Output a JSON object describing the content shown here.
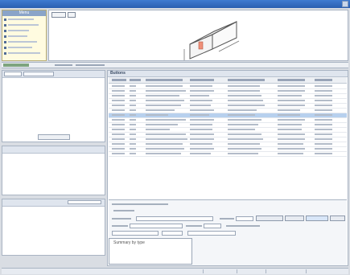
{
  "menu": {
    "title": "Menu"
  },
  "buttons": {
    "title": "Buttons"
  },
  "summary": {
    "title": "Summary"
  },
  "summary_by_type": {
    "title": "Summary by type"
  },
  "table": {
    "selected_row": 6
  }
}
